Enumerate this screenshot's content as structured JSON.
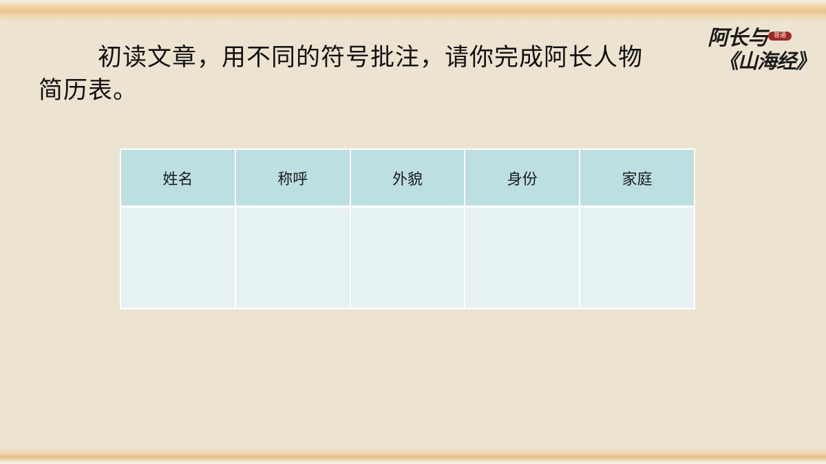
{
  "slide": {
    "instruction": "初读文章，用不同的符号批注，请你完成阿长人物简历表。"
  },
  "logo": {
    "line1": "阿长与",
    "seal": "普通",
    "line2": "《山海经》"
  },
  "table": {
    "headers": [
      "姓名",
      "称呼",
      "外貌",
      "身份",
      "家庭"
    ],
    "row": [
      "",
      "",
      "",
      "",
      ""
    ]
  },
  "colors": {
    "background": "#ede3d1",
    "header_fill": "#bcdfe2",
    "cell_fill": "#e5f1f2",
    "band_accent": "#e9c48c",
    "seal_red": "#9e2a22"
  }
}
